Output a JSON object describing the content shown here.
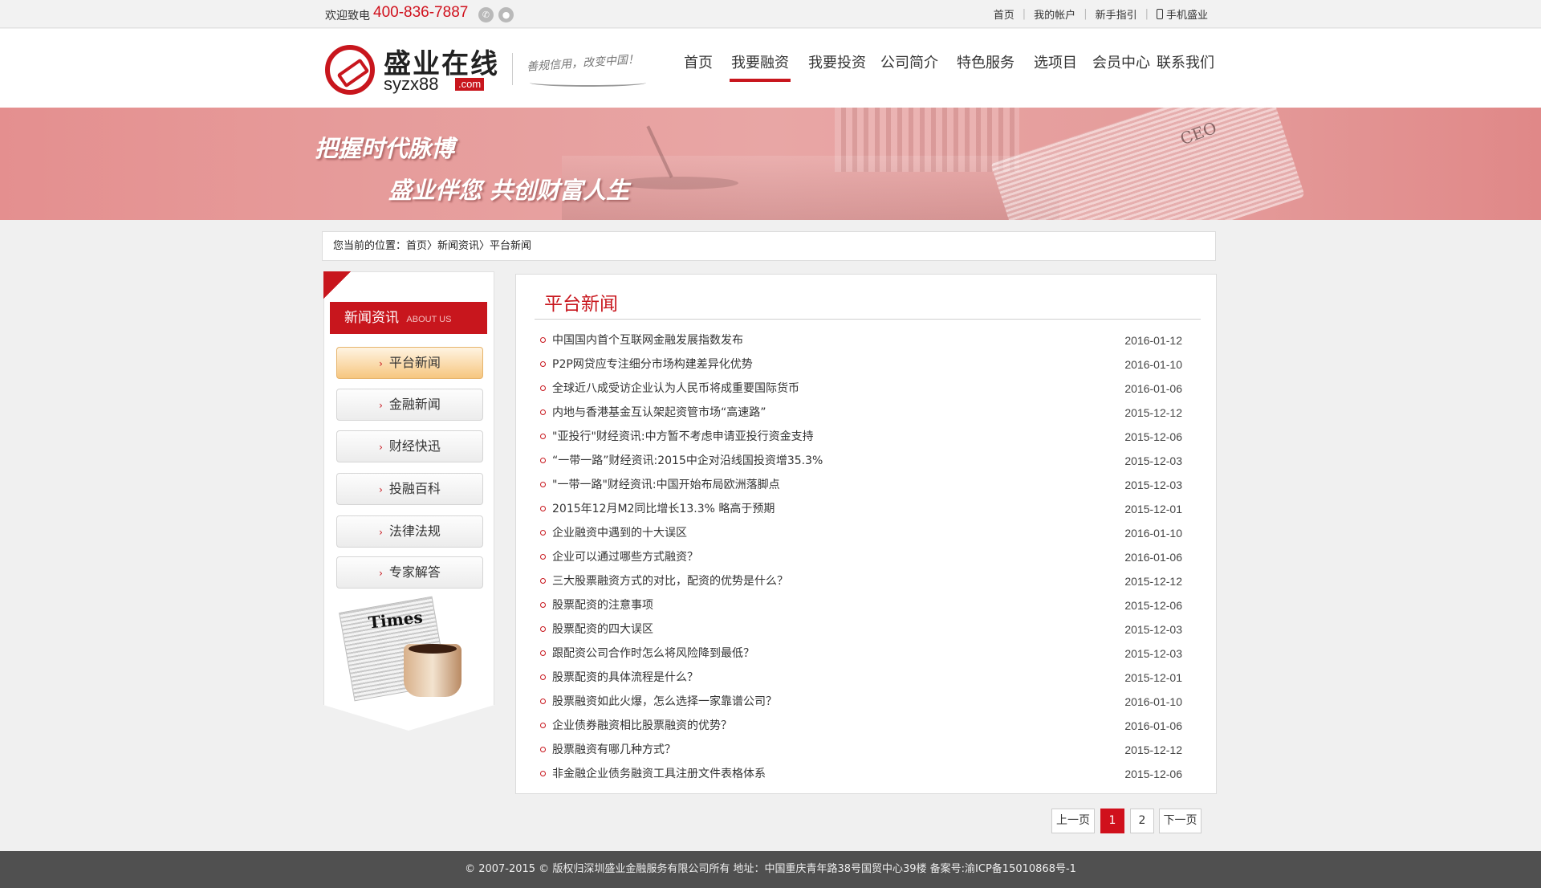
{
  "topbar": {
    "welcome": "欢迎致电",
    "phone": "400-836-7887",
    "links": [
      "首页",
      "我的帐户",
      "新手指引",
      "手机盛业"
    ],
    "icons": [
      "wechat-icon",
      "qq-icon",
      "mobile-phone-icon"
    ]
  },
  "logo": {
    "cn": "盛业在线",
    "en": "syzx88",
    "com": ".com",
    "slogan": "善规信用，改变中国！"
  },
  "nav": {
    "items": [
      "首页",
      "我要融资",
      "我要投资",
      "公司简介",
      "特色服务",
      "选项目",
      "会员中心",
      "联系我们"
    ],
    "active": "我要融资"
  },
  "banner": {
    "line1": "把握时代脉博",
    "line2": "盛业伴您  共创财富人生",
    "paper_text": "CEO"
  },
  "breadcrumb": "您当前的位置：首页〉新闻资讯〉平台新闻",
  "sidebar": {
    "title": "新闻资讯",
    "subtitle": "ABOUT US",
    "items": [
      "平台新闻",
      "金融新闻",
      "财经快迅",
      "投融百科",
      "法律法规",
      "专家解答"
    ],
    "active": "平台新闻",
    "image_text": "Times"
  },
  "main": {
    "title": "平台新闻",
    "news": [
      {
        "title": "中国国内首个互联网金融发展指数发布",
        "date": "2016-01-12"
      },
      {
        "title": "P2P网贷应专注细分市场构建差异化优势",
        "date": "2016-01-10"
      },
      {
        "title": "全球近八成受访企业认为人民币将成重要国际货币",
        "date": "2016-01-06"
      },
      {
        "title": "内地与香港基金互认架起资管市场“高速路”",
        "date": "2015-12-12"
      },
      {
        "title": "\"亚投行\"财经资讯:中方暂不考虑申请亚投行资金支持",
        "date": "2015-12-06"
      },
      {
        "title": "“一带一路”财经资讯:2015中企对沿线国投资增35.3%",
        "date": "2015-12-03"
      },
      {
        "title": "\"一带一路\"财经资讯:中国开始布局欧洲落脚点",
        "date": "2015-12-03"
      },
      {
        "title": "2015年12月M2同比增长13.3% 略高于预期",
        "date": "2015-12-01"
      },
      {
        "title": "企业融资中遇到的十大误区",
        "date": "2016-01-10"
      },
      {
        "title": "企业可以通过哪些方式融资？",
        "date": "2016-01-06"
      },
      {
        "title": "三大股票融资方式的对比，配资的优势是什么？",
        "date": "2015-12-12"
      },
      {
        "title": "股票配资的注意事项",
        "date": "2015-12-06"
      },
      {
        "title": "股票配资的四大误区",
        "date": "2015-12-03"
      },
      {
        "title": "跟配资公司合作时怎么将风险降到最低？",
        "date": "2015-12-03"
      },
      {
        "title": "股票配资的具体流程是什么？",
        "date": "2015-12-01"
      },
      {
        "title": "股票融资如此火爆，怎么选择一家靠谱公司？",
        "date": "2016-01-10"
      },
      {
        "title": "企业债券融资相比股票融资的优势？",
        "date": "2016-01-06"
      },
      {
        "title": "股票融资有哪几种方式？",
        "date": "2015-12-12"
      },
      {
        "title": "非金融企业债务融资工具注册文件表格体系",
        "date": "2015-12-06"
      }
    ]
  },
  "pagination": {
    "prev": "上一页",
    "pages": [
      "1",
      "2"
    ],
    "current": "1",
    "next": "下一页"
  },
  "footer": "© 2007-2015 © 版权归深圳盛业金融服务有限公司所有     地址：中国重庆青年路38号国贸中心39楼     备案号:渝ICP备15010868号-1",
  "colors": {
    "accent": "#c8161d",
    "banner": "#e69a99",
    "footer_bg": "#505050"
  }
}
